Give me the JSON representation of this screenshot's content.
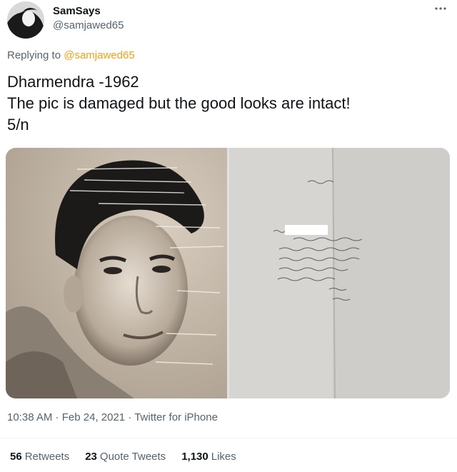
{
  "author": {
    "display_name": "SamSays",
    "handle": "@samjawed65"
  },
  "reply": {
    "prefix": "Replying to ",
    "to": "@samjawed65"
  },
  "tweet": {
    "lines": [
      "Dharmendra -1962",
      "The pic is damaged but the good looks are intact!",
      "5/n"
    ]
  },
  "meta": {
    "time": "10:38 AM",
    "sep1": " · ",
    "date": "Feb 24, 2021",
    "sep2": " · ",
    "source": "Twitter for iPhone"
  },
  "stats": {
    "retweets_count": "56",
    "retweets_label": "Retweets",
    "quotes_count": "23",
    "quotes_label": "Quote Tweets",
    "likes_count": "1,130",
    "likes_label": "Likes"
  },
  "icons": {
    "more": "more-icon"
  },
  "colors": {
    "link": "#f4a012",
    "muted": "#536471",
    "text": "#0f1419"
  }
}
